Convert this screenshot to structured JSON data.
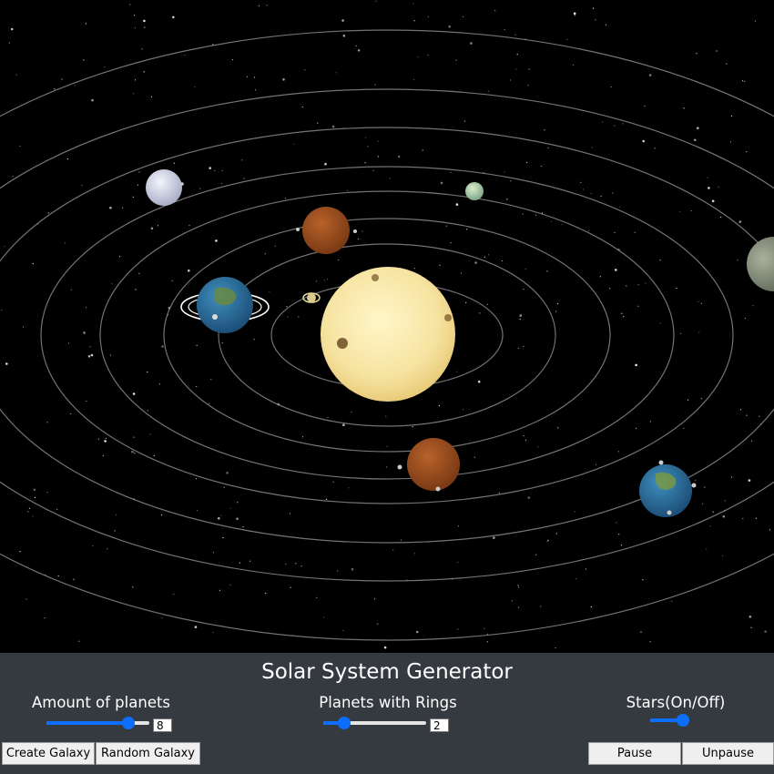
{
  "app": {
    "title": "Solar System Generator"
  },
  "controls": {
    "planets": {
      "label": "Amount of planets",
      "value": "8",
      "slider_fraction": 0.8
    },
    "rings": {
      "label": "Planets with Rings",
      "value": "2",
      "slider_fraction": 0.2
    },
    "stars": {
      "label": "Stars(On/Off)",
      "state": "on",
      "slider_fraction": 1.0
    }
  },
  "buttons": {
    "create": "Create Galaxy",
    "random": "Random Galaxy",
    "pause": "Pause",
    "unpause": "Unpause"
  },
  "colors": {
    "panel": "#353a40",
    "accent": "#0d6efd",
    "space": "#000000",
    "sun": "#f7e6a6"
  }
}
